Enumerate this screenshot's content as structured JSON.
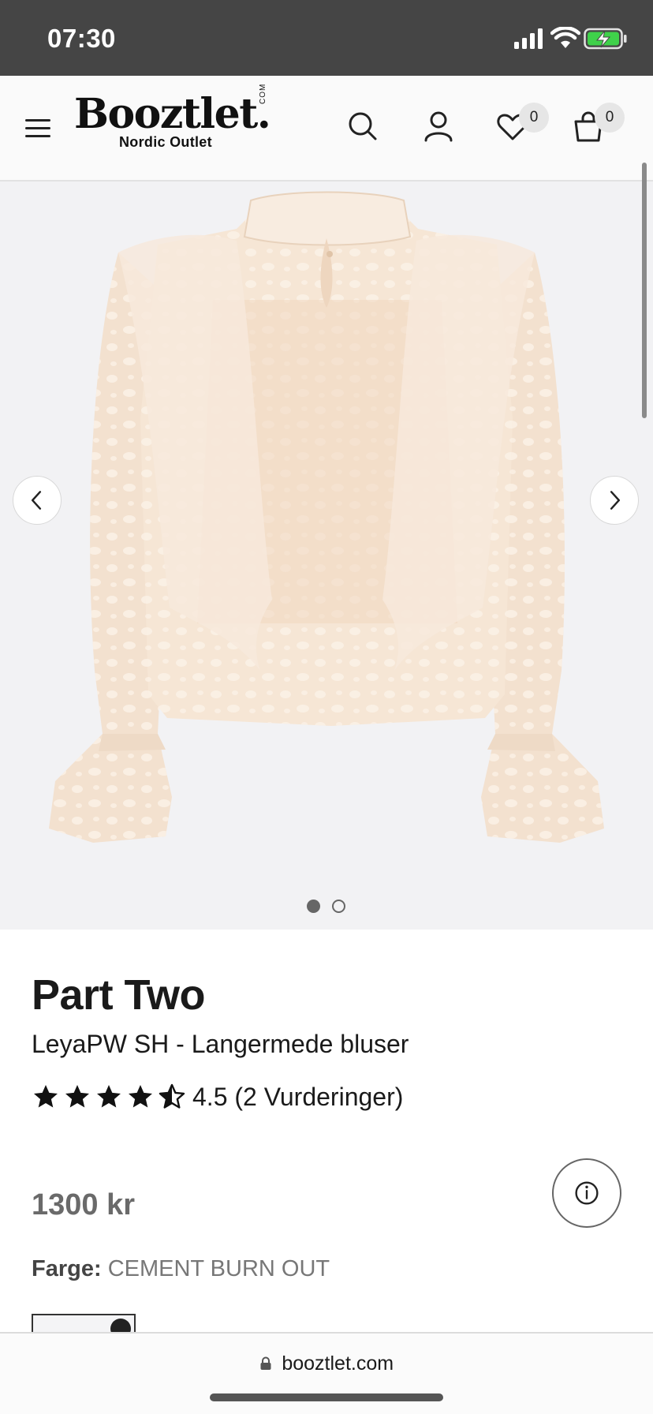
{
  "status_bar": {
    "time": "07:30"
  },
  "header": {
    "logo_text": "Booztlet.",
    "logo_com": "COM",
    "logo_sub": "Nordic Outlet",
    "wishlist_count": "0",
    "cart_count": "0"
  },
  "gallery": {
    "image_count": 2,
    "active_index": 1
  },
  "product": {
    "brand": "Part Two",
    "name": "LeyaPW SH - Langermede bluser",
    "rating": 4.5,
    "rating_text": "4.5 (2 Vurderinger)",
    "price": "1300 kr",
    "color_label": "Farge:",
    "color_value": "CEMENT BURN OUT"
  },
  "browser": {
    "url": "booztlet.com"
  },
  "colors": {
    "status_bg": "#454545",
    "battery_green": "#3fd14a",
    "header_bg": "#fafafa",
    "gallery_bg": "#f2f2f4",
    "blouse_fill": "#f5e4d3",
    "text_primary": "#1a1a1a",
    "price_gray": "#6a6a6a"
  }
}
